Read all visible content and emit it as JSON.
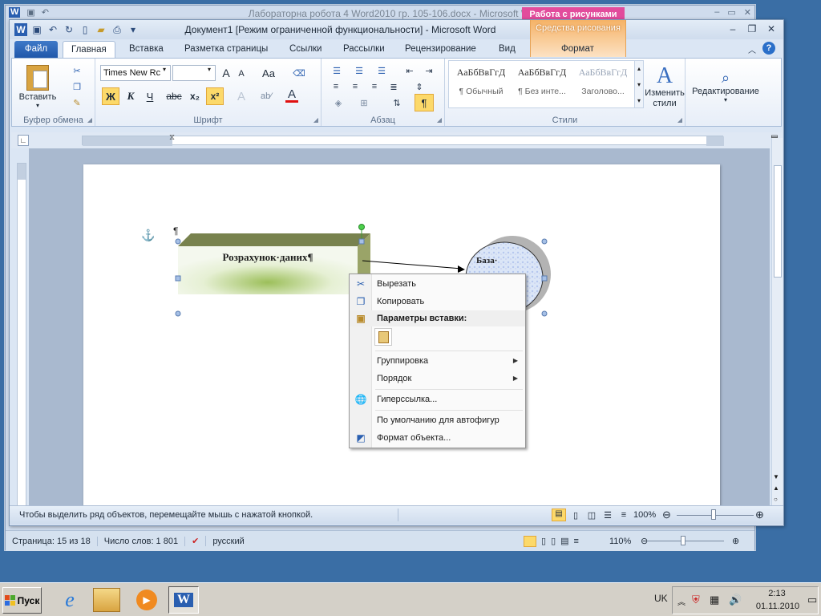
{
  "background_window": {
    "title": "Лабораторна робота 4 Word2010 гр. 105-106.docx - Microsoft Word",
    "context_tab": "Работа с рисунками",
    "status": {
      "page": "Страница: 15 из 18",
      "words": "Число слов: 1 801",
      "lang": "русский",
      "zoom": "110%"
    }
  },
  "window": {
    "title": "Документ1 [Режим ограниченной функциональности] - Microsoft Word",
    "context_tab": "Средства рисования"
  },
  "tabs": [
    "Файл",
    "Главная",
    "Вставка",
    "Разметка страницы",
    "Ссылки",
    "Рассылки",
    "Рецензирование",
    "Вид",
    "Формат"
  ],
  "ribbon": {
    "clipboard": {
      "paste": "Вставить",
      "label": "Буфер обмена"
    },
    "font": {
      "font_name": "Times New Rc",
      "bold": "Ж",
      "italic": "К",
      "underline": "Ч",
      "strike": "abc",
      "sub": "x₂",
      "sup": "x²",
      "grow": "A",
      "shrink": "A",
      "case": "Aa",
      "label": "Шрифт"
    },
    "paragraph": {
      "pilcrow": "¶",
      "label": "Абзац"
    },
    "styles": {
      "items": [
        {
          "sample": "АаБбВвГгД",
          "name": "¶ Обычный"
        },
        {
          "sample": "АаБбВвГгД",
          "name": "¶ Без инте..."
        },
        {
          "sample": "АаБбВвГгД",
          "name": "Заголово..."
        }
      ],
      "change": "Изменить стили",
      "label": "Стили"
    },
    "editing": {
      "label": "Редактирование"
    }
  },
  "doc": {
    "pilcrow": "¶",
    "shape_text": "Розрахунок·даних¶",
    "circle_text": "База·"
  },
  "context_menu": {
    "items": [
      {
        "label": "Вырезать",
        "icon": "scissors-icon"
      },
      {
        "label": "Копировать",
        "icon": "copy-icon"
      },
      {
        "label": "Параметры вставки:",
        "icon": "paste-icon"
      },
      {
        "label": "Группировка",
        "submenu": true
      },
      {
        "label": "Порядок",
        "submenu": true
      },
      {
        "label": "Гиперссылка...",
        "icon": "hyperlink-icon"
      },
      {
        "label": "По умолчанию для автофигур"
      },
      {
        "label": "Формат объекта...",
        "icon": "format-object-icon"
      }
    ]
  },
  "statusbar": {
    "hint": "Чтобы выделить ряд объектов, перемещайте мышь с нажатой кнопкой.",
    "zoom": "100%"
  },
  "taskbar": {
    "start": "Пуск",
    "lang": "UK",
    "time": "2:13",
    "date": "01.11.2010"
  },
  "colors": {
    "file_tab": "#2a5fb0",
    "context_tab": "#f5b266",
    "highlight": "#fcd96a"
  }
}
